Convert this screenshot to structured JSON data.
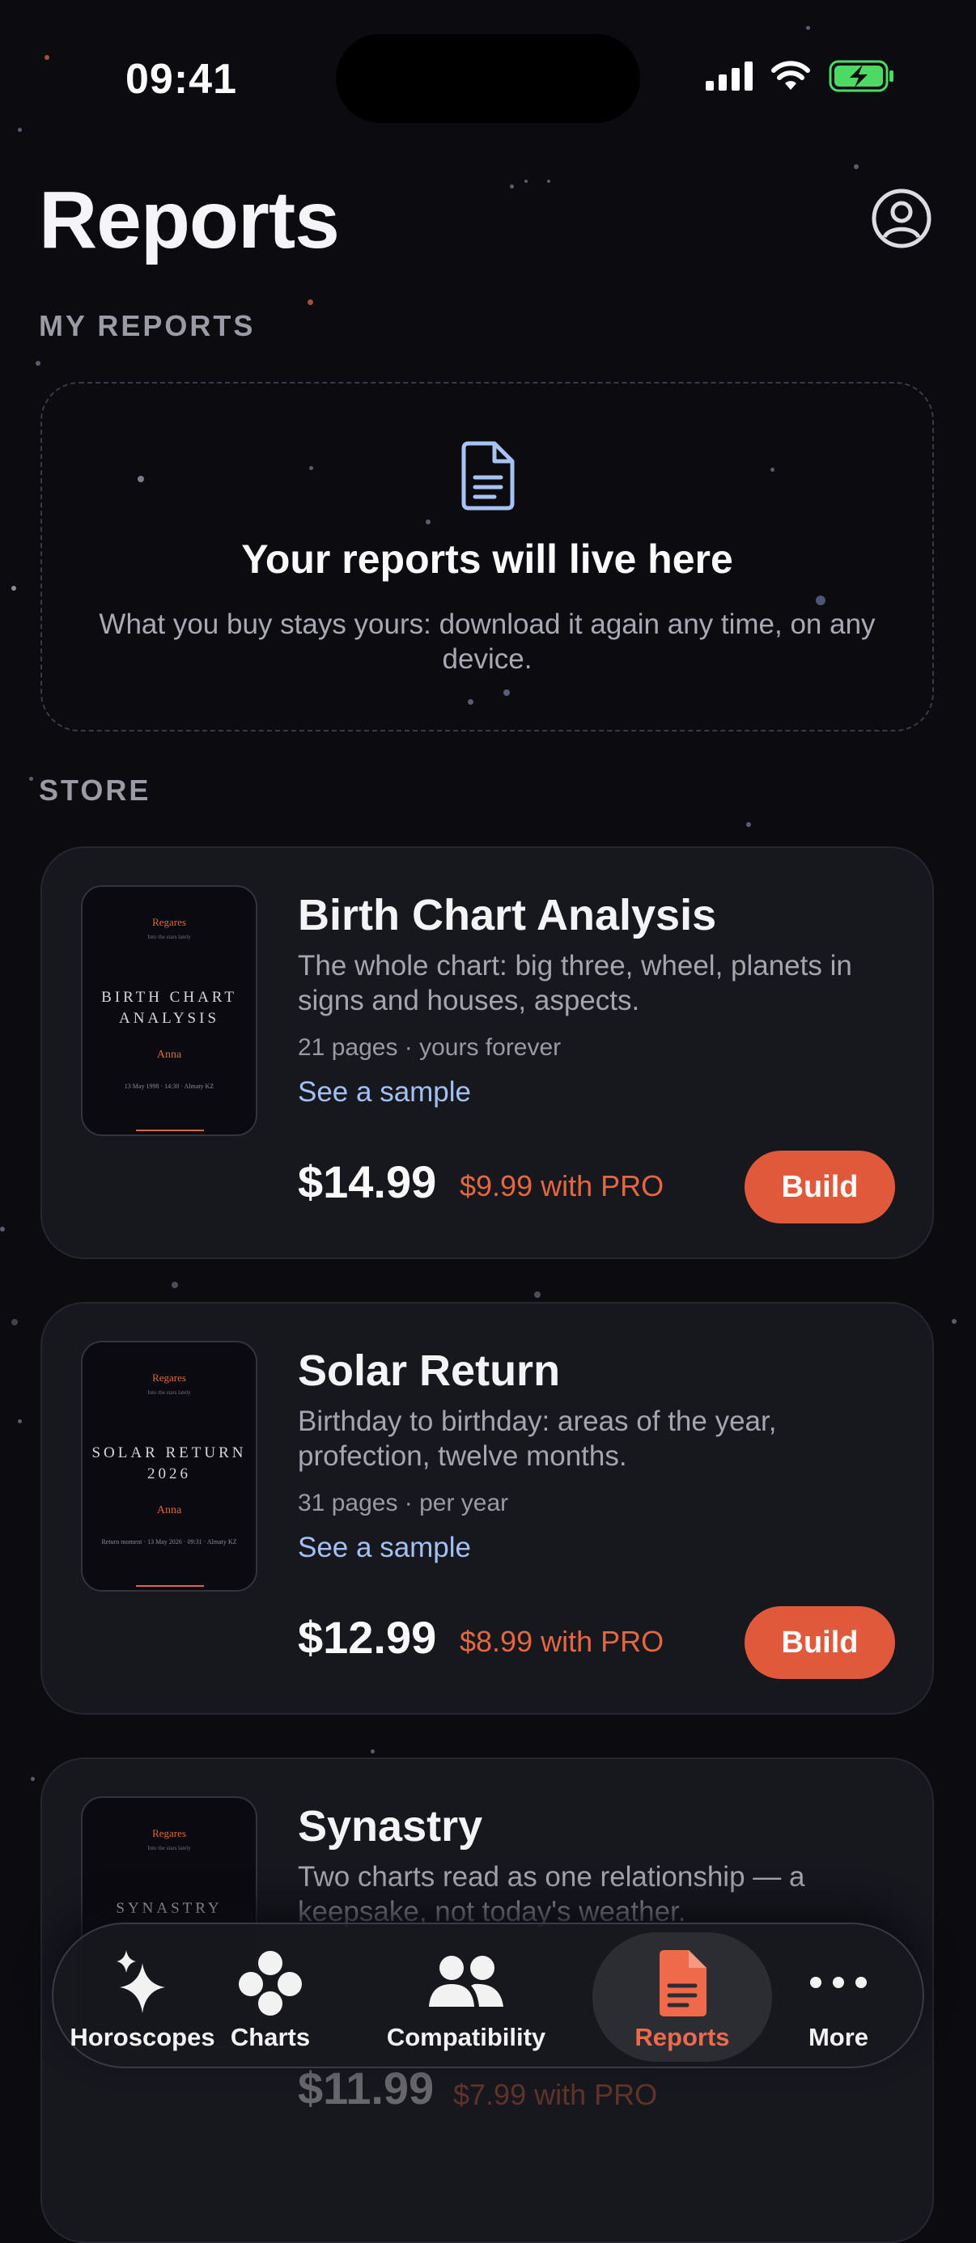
{
  "status": {
    "time": "09:41"
  },
  "header": {
    "title": "Reports"
  },
  "my_reports": {
    "label": "MY REPORTS",
    "empty_title": "Your reports will live here",
    "empty_subtitle": "What you buy stays yours: download it again any time, on any device."
  },
  "store": {
    "label": "STORE",
    "products": [
      {
        "title": "Birth Chart Analysis",
        "description": "The whole chart: big three, wheel, planets in signs and houses, aspects.",
        "pages": "21 pages · yours forever",
        "sample": "See a sample",
        "price": "$14.99",
        "pro_price": "$9.99 with PRO",
        "button": "Build",
        "cover": {
          "brand": "Regares",
          "tagline": "Into the stars lately",
          "title": "BIRTH CHART ANALYSIS",
          "name": "Anna",
          "meta": "13 May 1998 · 14:30 · Almaty KZ"
        }
      },
      {
        "title": "Solar Return",
        "description": "Birthday to birthday: areas of the year, profection, twelve months.",
        "pages": "31 pages · per year",
        "sample": "See a sample",
        "price": "$12.99",
        "pro_price": "$8.99 with PRO",
        "button": "Build",
        "cover": {
          "brand": "Regares",
          "tagline": "Into the stars lately",
          "title": "SOLAR RETURN 2026",
          "name": "Anna",
          "meta": "Return moment · 13 May 2026 · 09:31 · Almaty KZ"
        }
      },
      {
        "title": "Synastry",
        "description": "Two charts read as one relationship — a keepsake, not today's weather.",
        "price": "$11.99",
        "pro_price": "$7.99 with PRO",
        "cover": {
          "brand": "Regares",
          "tagline": "Into the stars lately",
          "title": "SYNASTRY"
        }
      }
    ]
  },
  "tabs": [
    {
      "label": "Horoscopes",
      "icon": "sparkles-icon"
    },
    {
      "label": "Charts",
      "icon": "charts-icon"
    },
    {
      "label": "Compatibility",
      "icon": "people-icon"
    },
    {
      "label": "Reports",
      "icon": "document-icon",
      "active": true
    },
    {
      "label": "More",
      "icon": "ellipsis-icon"
    }
  ],
  "colors": {
    "accent": "#e0593a",
    "link": "#a3c0f5",
    "background": "#0b0b10",
    "card": "#17171e"
  }
}
